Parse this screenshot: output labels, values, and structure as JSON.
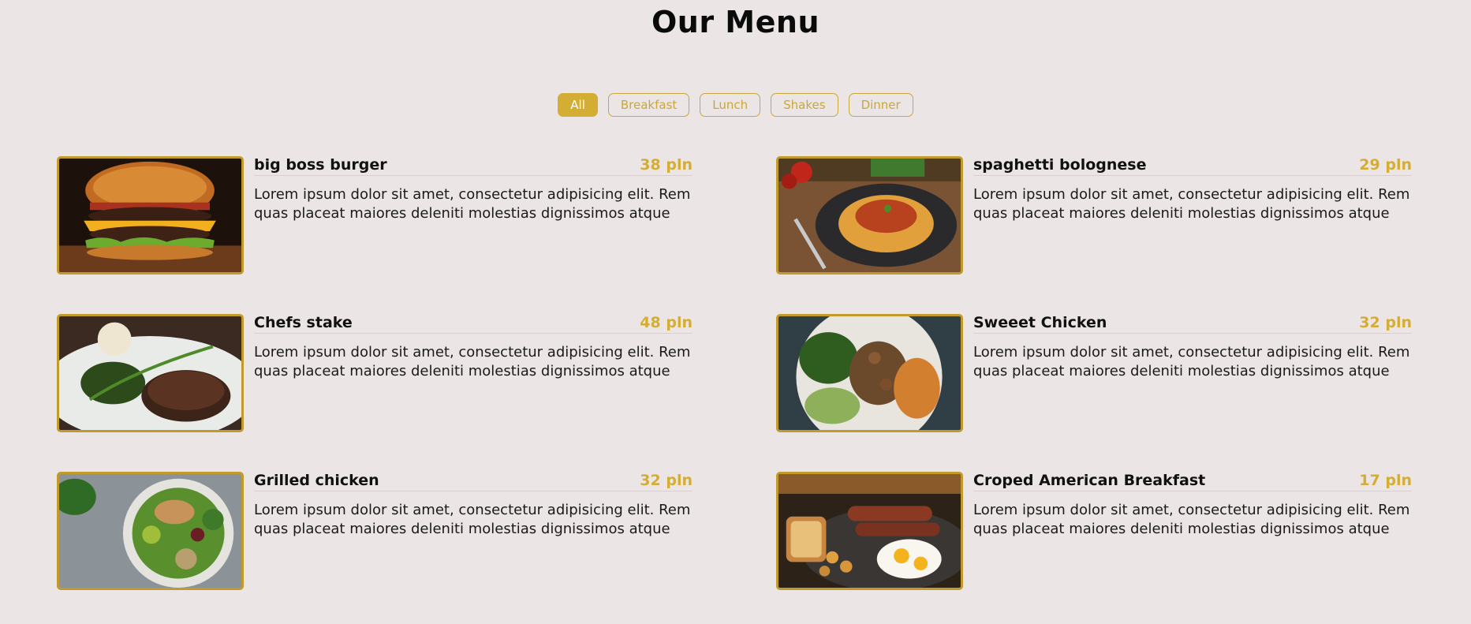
{
  "page": {
    "title": "Our Menu"
  },
  "filters": [
    {
      "label": "All",
      "active": true
    },
    {
      "label": "Breakfast",
      "active": false
    },
    {
      "label": "Lunch",
      "active": false
    },
    {
      "label": "Shakes",
      "active": false
    },
    {
      "label": "Dinner",
      "active": false
    }
  ],
  "items": [
    {
      "name": "big boss burger",
      "price": "38 pln",
      "desc": "Lorem ipsum dolor sit amet, consectetur adipisicing elit. Rem quas placeat maiores deleniti molestias dignissimos atque",
      "image": "burger-photo"
    },
    {
      "name": "spaghetti bolognese",
      "price": "29 pln",
      "desc": "Lorem ipsum dolor sit amet, consectetur adipisicing elit. Rem quas placeat maiores deleniti molestias dignissimos atque",
      "image": "spaghetti-photo"
    },
    {
      "name": "Chefs stake",
      "price": "48 pln",
      "desc": "Lorem ipsum dolor sit amet, consectetur adipisicing elit. Rem quas placeat maiores deleniti molestias dignissimos atque",
      "image": "steak-photo"
    },
    {
      "name": "Sweeet Chicken",
      "price": "32 pln",
      "desc": "Lorem ipsum dolor sit amet, consectetur adipisicing elit. Rem quas placeat maiores deleniti molestias dignissimos atque",
      "image": "chicken-bowl-photo"
    },
    {
      "name": "Grilled chicken",
      "price": "32 pln",
      "desc": "Lorem ipsum dolor sit amet, consectetur adipisicing elit. Rem quas placeat maiores deleniti molestias dignissimos atque",
      "image": "salad-bowl-photo"
    },
    {
      "name": "Croped American Breakfast",
      "price": "17 pln",
      "desc": "Lorem ipsum dolor sit amet, consectetur adipisicing elit. Rem quas placeat maiores deleniti molestias dignissimos atque",
      "image": "breakfast-photo"
    }
  ],
  "colors": {
    "accent": "#d4ad35",
    "background": "#ebe5e5",
    "frame": "#c19a2c"
  }
}
